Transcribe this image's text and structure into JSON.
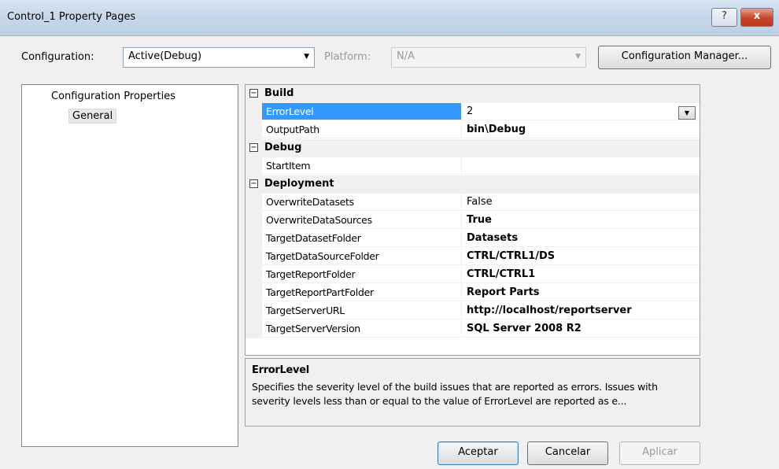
{
  "window": {
    "title": "Control_1 Property Pages",
    "help_label": "?",
    "close_label": "x"
  },
  "config": {
    "configuration_label": "Configuration:",
    "configuration_value": "Active(Debug)",
    "platform_label": "Platform:",
    "platform_value": "N/A",
    "manager_button": "Configuration Manager..."
  },
  "tree": {
    "root": "Configuration Properties",
    "selected_child": "General"
  },
  "grid": {
    "categories": [
      {
        "name": "Build",
        "toggle": "−"
      },
      {
        "name": "Debug",
        "toggle": "−"
      },
      {
        "name": "Deployment",
        "toggle": "−"
      }
    ],
    "build": [
      {
        "name": "ErrorLevel",
        "value": "2"
      },
      {
        "name": "OutputPath",
        "value": "bin\\Debug"
      }
    ],
    "debug": [
      {
        "name": "StartItem",
        "value": ""
      }
    ],
    "deployment": [
      {
        "name": "OverwriteDatasets",
        "value": "False"
      },
      {
        "name": "OverwriteDataSources",
        "value": "True"
      },
      {
        "name": "TargetDatasetFolder",
        "value": "Datasets"
      },
      {
        "name": "TargetDataSourceFolder",
        "value": "CTRL/CTRL1/DS"
      },
      {
        "name": "TargetReportFolder",
        "value": "CTRL/CTRL1"
      },
      {
        "name": "TargetReportPartFolder",
        "value": "Report Parts"
      },
      {
        "name": "TargetServerURL",
        "value": "http://localhost/reportserver"
      },
      {
        "name": "TargetServerVersion",
        "value": "SQL Server 2008 R2"
      }
    ]
  },
  "description": {
    "title": "ErrorLevel",
    "text": "Specifies the severity level of the build issues that are reported as errors. Issues with severity levels less than or equal to the value of ErrorLevel are reported as e..."
  },
  "buttons": {
    "accept": "Aceptar",
    "cancel": "Cancelar",
    "apply": "Aplicar"
  },
  "colors": {
    "selection": "#3399ff",
    "title_bar": "#c4d5e8",
    "close_button": "#c8452a"
  }
}
